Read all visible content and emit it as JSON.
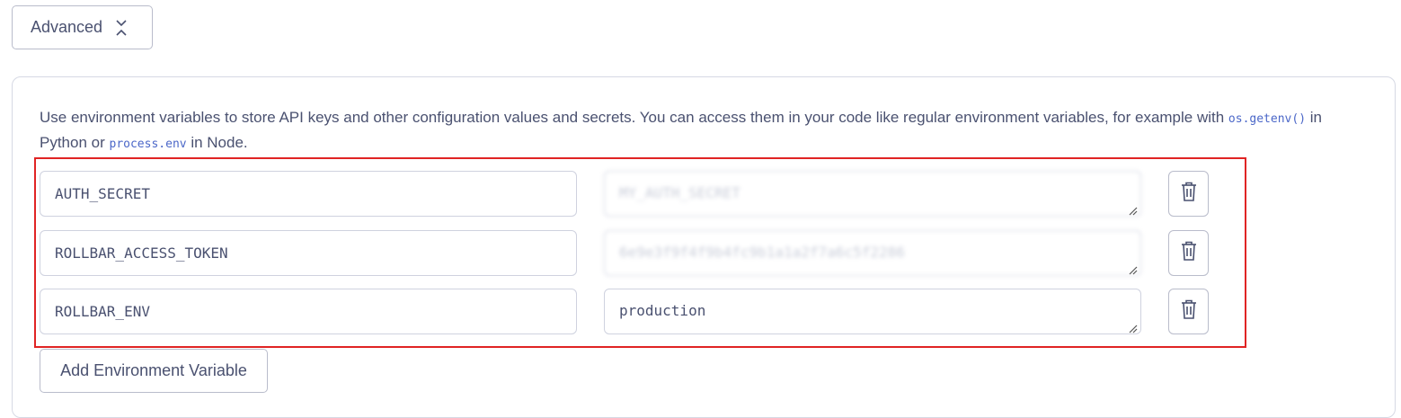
{
  "advanced": {
    "label": "Advanced",
    "icon": "chevrons-collapse-icon"
  },
  "panel": {
    "description": {
      "before": "Use environment variables to store API keys and other configuration values and secrets. You can access them in your code like regular environment variables, for example with ",
      "code1": "os.getenv()",
      "middle": " in Python or ",
      "code2": "process.env",
      "after": " in Node."
    },
    "env_vars": [
      {
        "key": "AUTH_SECRET",
        "value": "MY_AUTH_SECRET",
        "masked": true
      },
      {
        "key": "ROLLBAR_ACCESS_TOKEN",
        "value": "6e9e3f9f4f9b4fc9b1a1a2f7a6c5f2286",
        "masked": true
      },
      {
        "key": "ROLLBAR_ENV",
        "value": "production",
        "masked": false
      }
    ],
    "add_button_label": "Add Environment Variable"
  },
  "colors": {
    "highlight_border": "#e02424",
    "code": "#4b67c8",
    "text": "#4a5170"
  }
}
